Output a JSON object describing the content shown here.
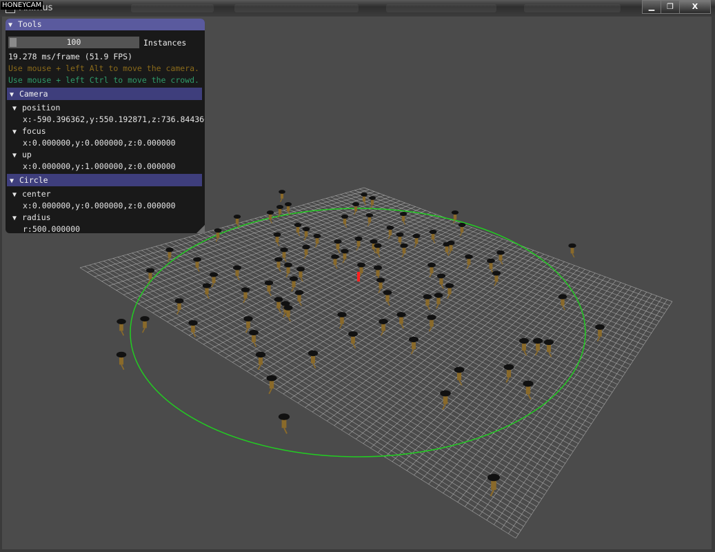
{
  "window": {
    "title": "Animus",
    "watermark": "HONEYCAM",
    "controls": {
      "minimize": "▁",
      "maximize": "❐",
      "close": "X"
    }
  },
  "tools": {
    "title": "Tools",
    "instances": {
      "value": "100",
      "label": "Instances"
    },
    "frame_time": "19.278 ms/frame (51.9 FPS)",
    "hint_camera": "Use mouse + left Alt to move the camera.",
    "hint_crowd": "Use mouse + left Ctrl to move the crowd.",
    "camera": {
      "title": "Camera",
      "position_label": "position",
      "position_value": "x:-590.396362,y:550.192871,z:736.844360",
      "focus_label": "focus",
      "focus_value": "x:0.000000,y:0.000000,z:0.000000",
      "up_label": "up",
      "up_value": "x:0.000000,y:1.000000,z:0.000000"
    },
    "circle": {
      "title": "Circle",
      "center_label": "center",
      "center_value": "x:0.000000,y:0.000000,z:0.000000",
      "radius_label": "radius",
      "radius_value": "r:500.000000"
    }
  },
  "colors": {
    "viewport_bg": "#4b4b4b",
    "grid_line": "#d8d8d8",
    "circle": "#22cc22",
    "agent_body": "#8a6a2a",
    "agent_hat": "#111111",
    "selected_agent": "#ff2020",
    "panel_header": "#5a5a9e",
    "section_header": "#3e3e7c"
  },
  "icons": {
    "tree_open": "triangle-down-icon",
    "app": "window-icon"
  }
}
